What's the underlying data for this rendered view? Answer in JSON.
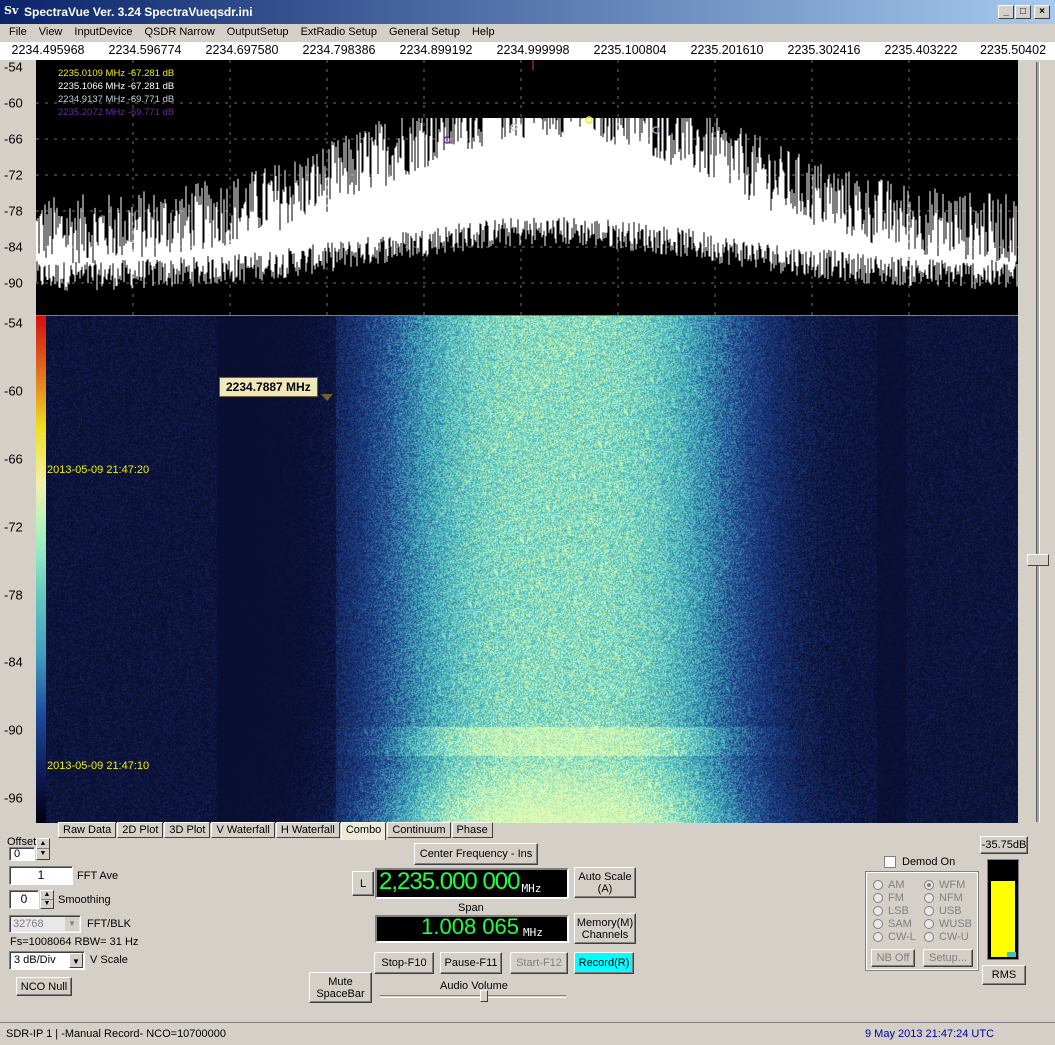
{
  "window": {
    "title": "SpectraVue Ver. 3.24  SpectraVueqsdr.ini",
    "icon_text": "Sv",
    "minimize_glyph": "_",
    "maximize_glyph": "□",
    "close_glyph": "×"
  },
  "menu": [
    "File",
    "View",
    "InputDevice",
    "QSDR Narrow",
    "OutputSetup",
    "ExtRadio Setup",
    "General Setup",
    "Help"
  ],
  "freq_axis_labels": [
    "2234.495968",
    "2234.596774",
    "2234.697580",
    "2234.798386",
    "2234.899192",
    "2234.999998",
    "2235.100804",
    "2235.201610",
    "2235.302416",
    "2235.403222",
    "2235.50402"
  ],
  "spectrum": {
    "y_labels": [
      "-54",
      "-60",
      "-66",
      "-72",
      "-78",
      "-84",
      "-90"
    ],
    "markers": [
      {
        "text": "2235.0109 MHz  -67.281  dB",
        "color": "#f0f000"
      },
      {
        "text": "2235.1066 MHz  -67.281  dB",
        "color": "#ffffff"
      },
      {
        "text": "2234.9137 MHz  -69.771  dB",
        "color": "#c0d0d0"
      },
      {
        "text": "2235.2072 MHz  -69.771  dB",
        "color": "#6a2aa0"
      }
    ]
  },
  "waterfall": {
    "y_labels": [
      "-54",
      "-60",
      "-66",
      "-72",
      "-78",
      "-84",
      "-90",
      "-96"
    ],
    "timestamp_top": "2013-05-09 21:47:20",
    "timestamp_bottom": "2013-05-09 21:47:10",
    "cursor_tooltip": "2234.7887 MHz"
  },
  "tabs": [
    "Raw Data",
    "2D Plot",
    "3D Plot",
    "V Waterfall",
    "H Waterfall",
    "Combo",
    "Continuum",
    "Phase"
  ],
  "active_tab": "Combo",
  "controls": {
    "offset_label": "Offset",
    "offset_value": "0",
    "fft_ave_value": "1",
    "fft_ave_label": "FFT Ave",
    "smoothing_value": "0",
    "smoothing_label": "Smoothing",
    "fft_blk_value": "32768",
    "fft_blk_label": "FFT/BLK",
    "fs_rbw": "Fs=1008064 RBW=  31 Hz",
    "vscale_value": "3 dB/Div",
    "vscale_label": "V Scale",
    "nco_null": "NCO Null",
    "mute_line1": "Mute",
    "mute_line2": "SpaceBar",
    "center_freq_button": "Center Frequency - Ins",
    "l_button": "L",
    "center_freq_value": "2,235.000 000",
    "center_freq_unit": "MHz",
    "auto_scale_line1": "Auto Scale",
    "auto_scale_line2": "(A)",
    "span_label": "Span",
    "span_value": "1.008 065",
    "span_unit": "MHz",
    "memory_line1": "Memory(M)",
    "memory_line2": "Channels",
    "stop": "Stop-F10",
    "pause": "Pause-F11",
    "start": "Start-F12",
    "record": "Record(R)",
    "audio_volume": "Audio Volume",
    "audio_volume_level": 0.56,
    "level_readout": "-35.75dB",
    "level_fill": 0.8,
    "demod_on": "Demod On",
    "demod_modes_left": [
      "AM",
      "FM",
      "LSB",
      "SAM",
      "CW-L"
    ],
    "demod_modes_right": [
      "WFM",
      "NFM",
      "USB",
      "WUSB",
      "CW-U"
    ],
    "demod_selected": "WFM",
    "nb_off": "NB Off",
    "setup": "Setup...",
    "rms": "RMS"
  },
  "status": {
    "left": "SDR-IP 1  | -Manual Record-   NCO=10700000",
    "right": "9 May 2013  21:47:24 UTC"
  },
  "colors": {
    "lcd_green": "#20ff40",
    "record_cyan": "#00ffff",
    "level_yellow": "#ffff00",
    "status_right_blue": "#0000a0"
  }
}
